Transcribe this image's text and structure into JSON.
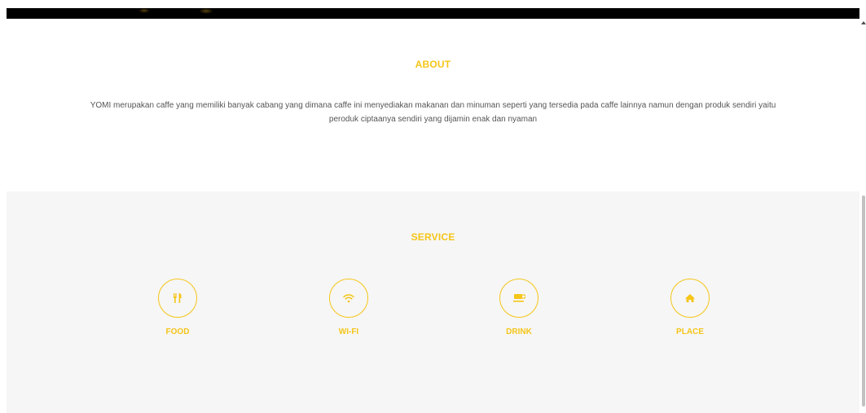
{
  "about": {
    "title": "ABOUT",
    "text": "YOMI merupakan caffe yang memiliki banyak cabang yang dimana caffe ini menyediakan makanan dan minuman seperti yang tersedia pada caffe lainnya namun dengan produk sendiri yaitu peroduk ciptaanya sendiri yang dijamin enak dan nyaman"
  },
  "service": {
    "title": "SERVICE",
    "items": [
      {
        "label": "FOOD",
        "icon": "cutlery-icon"
      },
      {
        "label": "WI-FI",
        "icon": "wifi-icon"
      },
      {
        "label": "DRINK",
        "icon": "coffee-cup-icon"
      },
      {
        "label": "PLACE",
        "icon": "home-icon"
      }
    ]
  },
  "colors": {
    "accent": "#f5c518",
    "text": "#555555",
    "service_background": "#f6f6f6"
  }
}
